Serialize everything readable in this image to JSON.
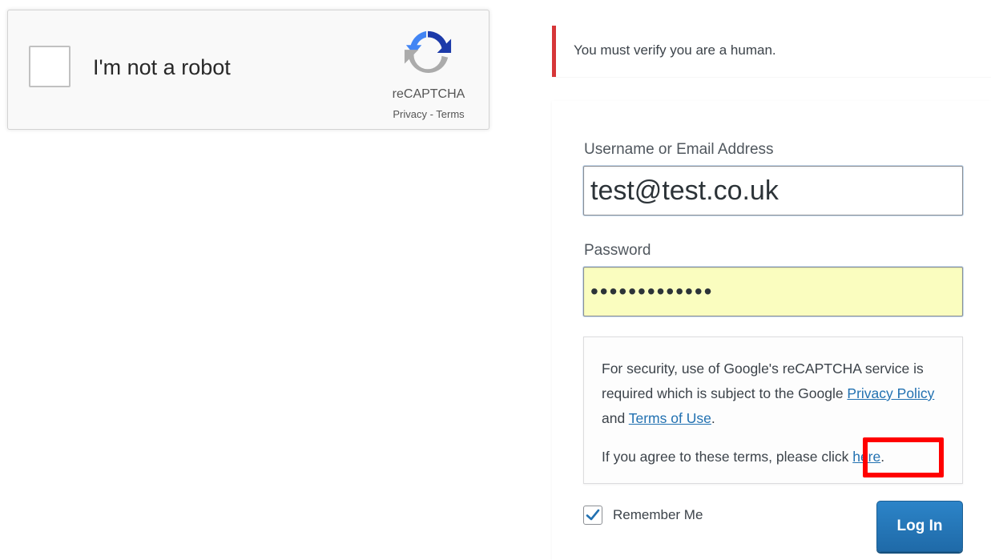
{
  "recaptcha": {
    "checkbox_label": "I'm not a robot",
    "brand": "reCAPTCHA",
    "privacy_link": "Privacy",
    "separator": " - ",
    "terms_link": "Terms"
  },
  "notice": {
    "message": "You must verify you are a human."
  },
  "login": {
    "username_label": "Username or Email Address",
    "username_value": "test@test.co.uk",
    "password_label": "Password",
    "password_value": "•••••••••••••",
    "terms_text_1": "For security, use of Google's reCAPTCHA service is required which is subject to the Google ",
    "privacy_policy_link": "Privacy Policy",
    "and_text": " and ",
    "terms_of_use_link": "Terms of Use",
    "period": ".",
    "agree_text": "If you agree to these terms, please click ",
    "here_link": "here",
    "agree_period": ".",
    "remember_me": "Remember Me",
    "remember_checked": true,
    "login_button": "Log In"
  },
  "colors": {
    "error_border": "#d63638",
    "link": "#2271b1",
    "button": "#2271b1",
    "highlight": "#ff0000",
    "autofill": "#fafdbf"
  },
  "icons": [
    "recaptcha-logo-icon",
    "checkmark-icon"
  ]
}
